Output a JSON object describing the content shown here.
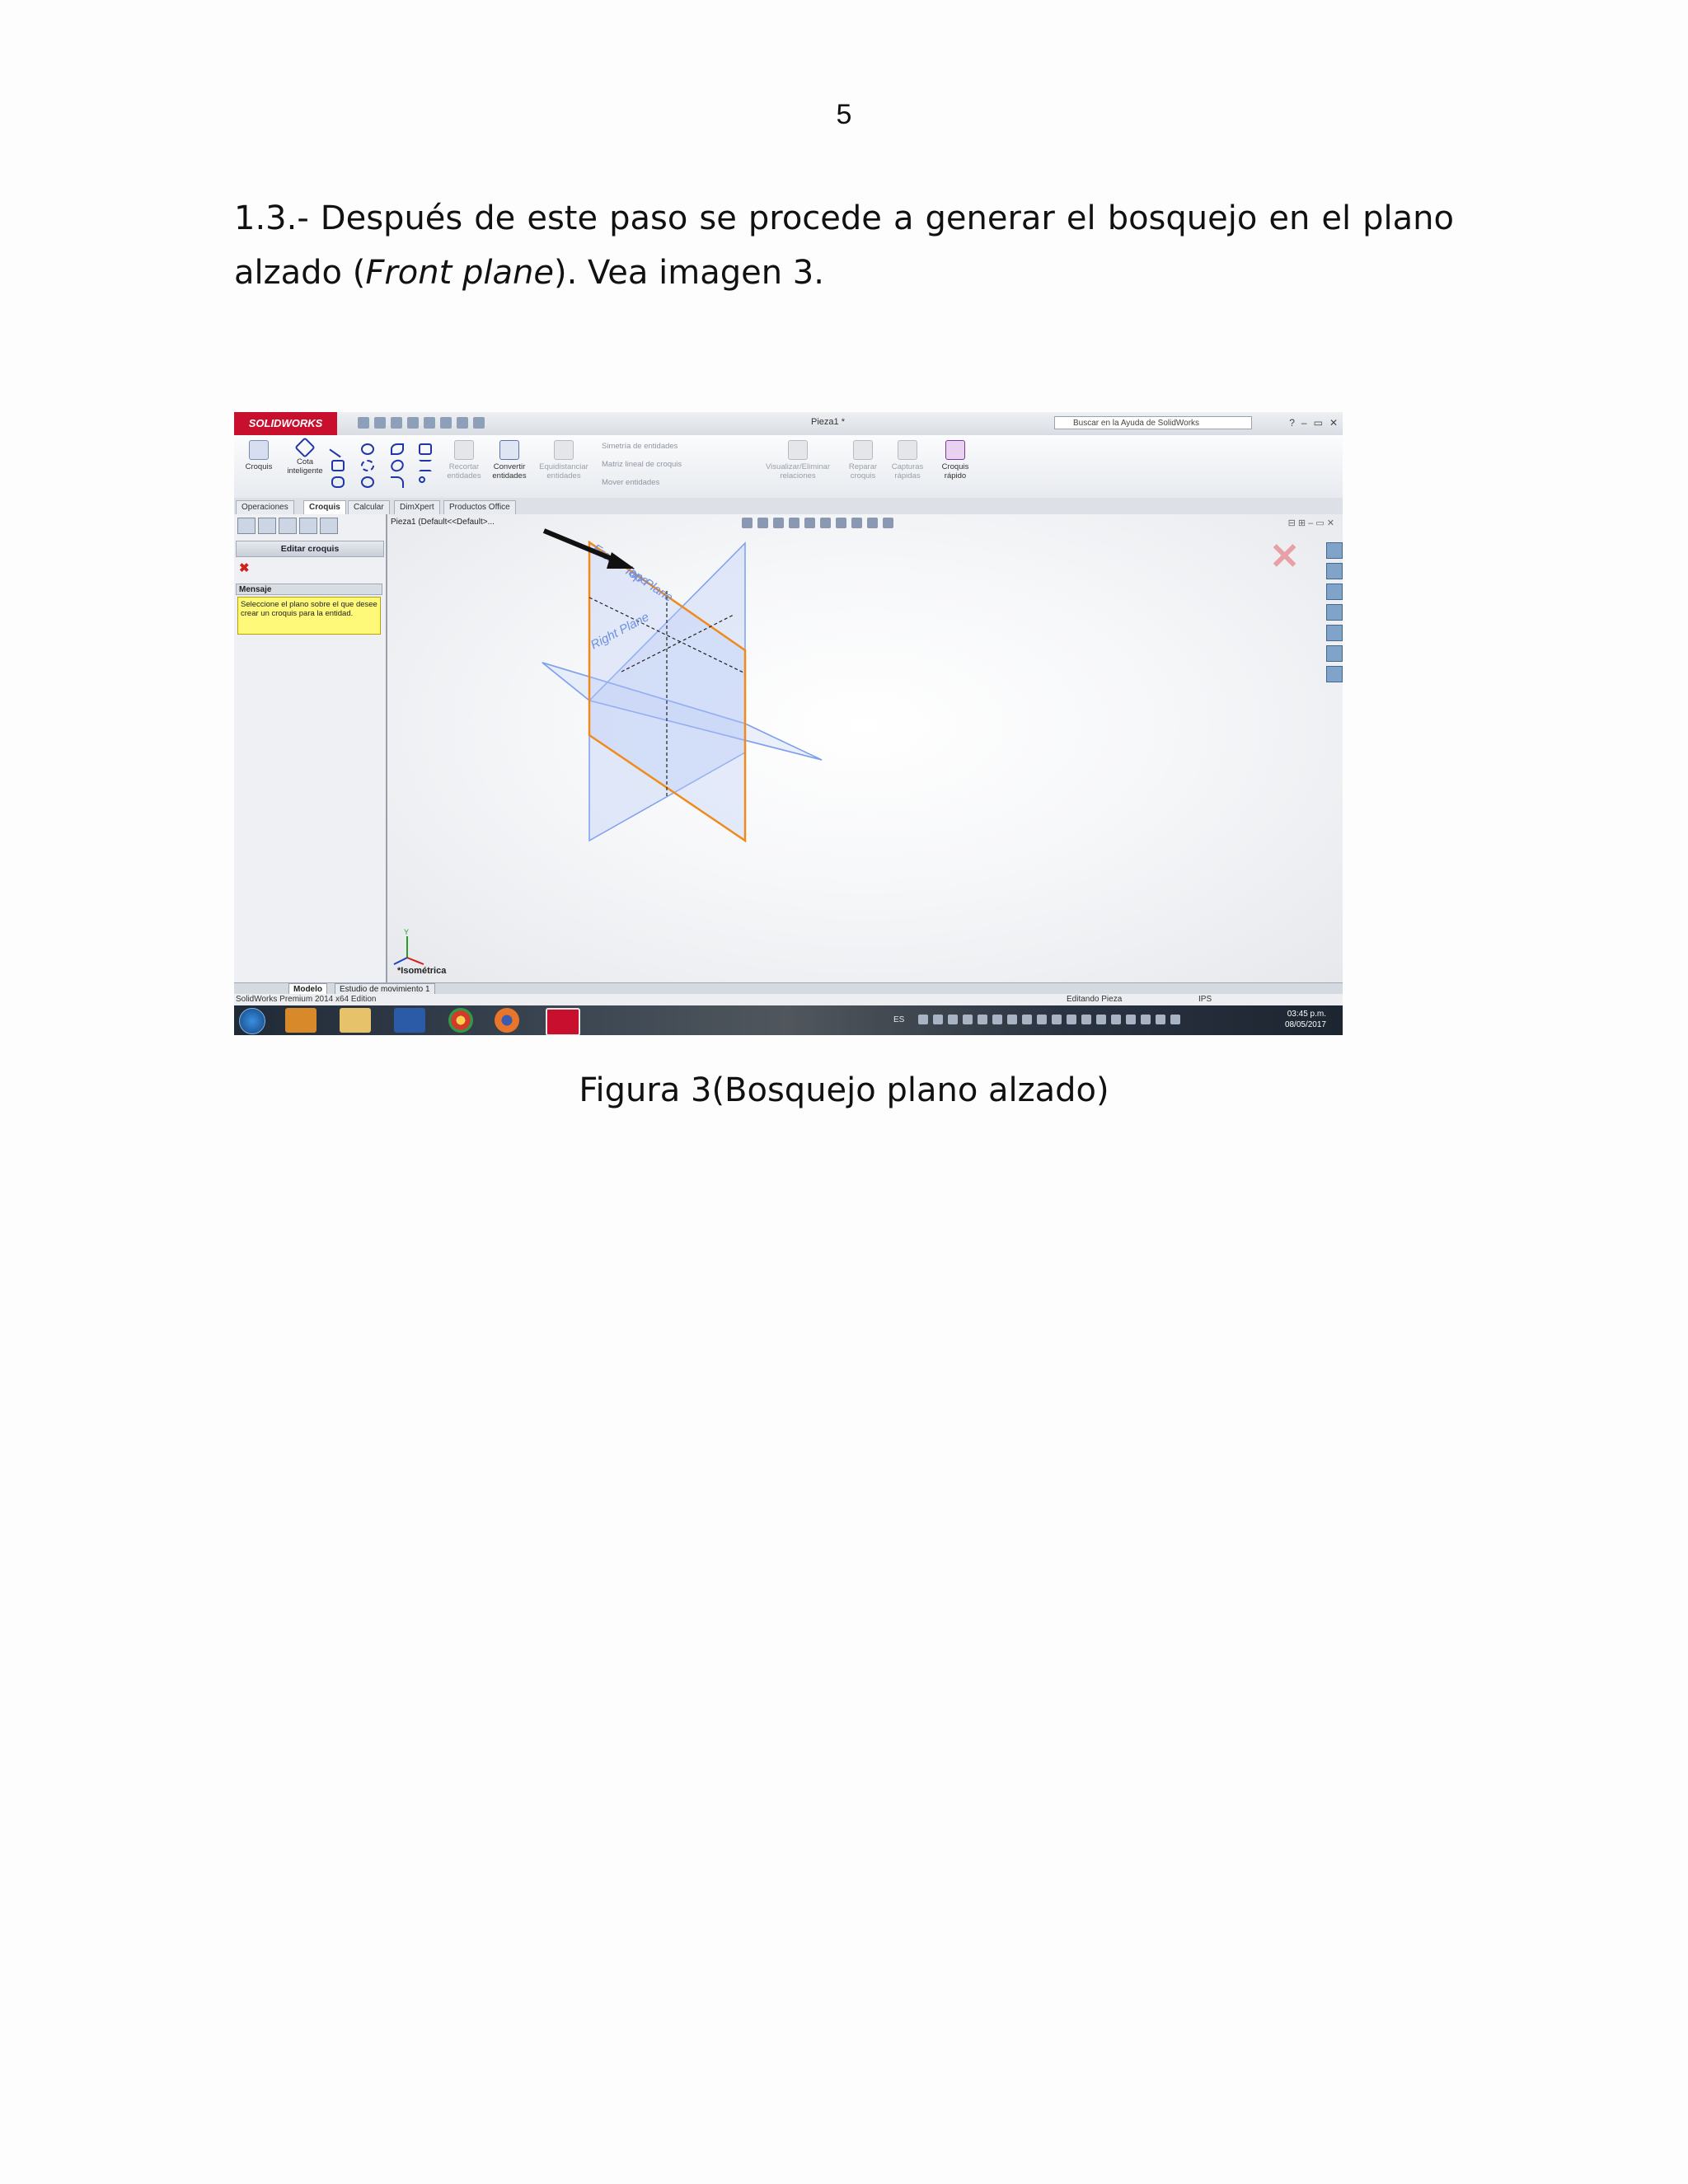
{
  "page": {
    "number": "5",
    "paragraph": {
      "lead": "1.3.- Después de este paso se procede a generar el bosquejo en el plano alzado (",
      "italic": "Front plane",
      "tail": "). Vea imagen 3."
    },
    "caption": "Figura 3(Bosquejo plano alzado)"
  },
  "screenshot": {
    "app_logo": "SOLIDWORKS",
    "document_title": "Pieza1 *",
    "search_placeholder": "Buscar en la Ayuda de SolidWorks",
    "window_controls": [
      "?",
      "–",
      "▭",
      "✕"
    ],
    "ribbon": {
      "croquis": "Croquis",
      "cota": "Cota inteligente",
      "recortar": "Recortar entidades",
      "convertir": "Convertir entidades",
      "equidistanciar": "Equidistanciar entidades",
      "simetria": "Simetría de entidades",
      "matriz": "Matriz lineal de croquis",
      "mover": "Mover entidades",
      "visualizar": "Visualizar/Eliminar relaciones",
      "reparar": "Reparar croquis",
      "capturas": "Capturas rápidas",
      "croquis_rapido": "Croquis rápido"
    },
    "tabs": [
      "Operaciones",
      "Croquis",
      "Calcular",
      "DimXpert",
      "Productos Office"
    ],
    "active_tab": "Croquis",
    "left_panel": {
      "header": "Editar croquis",
      "message_title": "Mensaje",
      "message": "Seleccione el plano sobre el que desee crear un croquis para la entidad."
    },
    "feature_tree": "Pieza1 (Default<<Default>...",
    "planes": {
      "front": "Front Plane",
      "top": "Top Plane",
      "right": "Right Plane"
    },
    "axis_label": "Y",
    "view_label": "*Isométrica",
    "bottom_tabs": [
      "Modelo",
      "Estudio de movimiento 1"
    ],
    "status": {
      "edition": "SolidWorks Premium 2014 x64 Edition",
      "mode": "Editando Pieza",
      "units": "IPS"
    },
    "taskbar": {
      "language": "ES",
      "time": "03:45 p.m.",
      "date": "08/05/2017"
    },
    "colors": {
      "selected_plane": "#f08a1c",
      "plane": "#7f9ff0",
      "plane_label": "#6f8fe0"
    }
  }
}
